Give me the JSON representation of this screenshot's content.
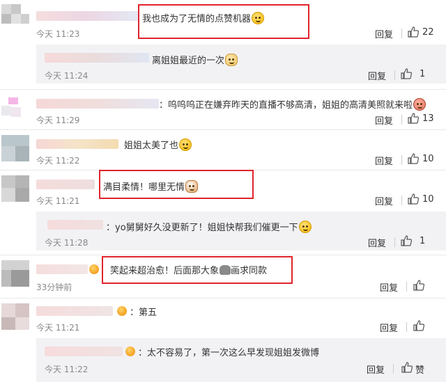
{
  "comments": [
    {
      "id": "c1",
      "text": "我也成为了无情的点赞机器",
      "emoji": "smile-emoji",
      "time": "今天 11:23",
      "reply_label": "回复",
      "likes": "22"
    },
    {
      "id": "r1",
      "text": "离姐姐最近的一次",
      "emoji": "dog-emoji",
      "time": "今天 11:24",
      "reply_label": "回复",
      "likes": "1"
    },
    {
      "id": "c2",
      "text": "：呜呜呜正在嫌弃昨天的直播不够高清，姐姐的高清美照就来啦",
      "emoji": "pig-emoji",
      "time": "今天 11:29",
      "reply_label": "回复",
      "likes": "13"
    },
    {
      "id": "c3",
      "text": "姐姐太美了也",
      "emoji": "shy-emoji",
      "time": "今天 11:22",
      "reply_label": "回复",
      "likes": "10"
    },
    {
      "id": "c4",
      "text": "满目柔情！哪里无情",
      "emoji": "cat-emoji",
      "time": "今天 11:21",
      "reply_label": "回复",
      "likes": "10"
    },
    {
      "id": "r2",
      "text": "：yo舅舅好久没更新了！姐姐快帮我们催更一下",
      "emoji": "tongue-emoji",
      "time": "今天 11:28",
      "reply_label": "回复",
      "likes": "1"
    },
    {
      "id": "c5",
      "text_a": "笑起来超治愈！后面那大象",
      "text_b": "画求同款",
      "emoji": "elephant-emoji",
      "time": "33分钟前",
      "reply_label": "回复",
      "likes": ""
    },
    {
      "id": "c6",
      "text": "：第五",
      "time": "今天 11:21",
      "reply_label": "回复",
      "likes": ""
    },
    {
      "id": "r3",
      "text": "：太不容易了，第一次这么早发现姐姐发微博",
      "time": "今天 11:22",
      "reply_label": "回复",
      "likes": "赞"
    }
  ],
  "colors": {
    "highlight": "#e0242c",
    "reply_bg": "#f2f2f5",
    "time": "#888888"
  }
}
